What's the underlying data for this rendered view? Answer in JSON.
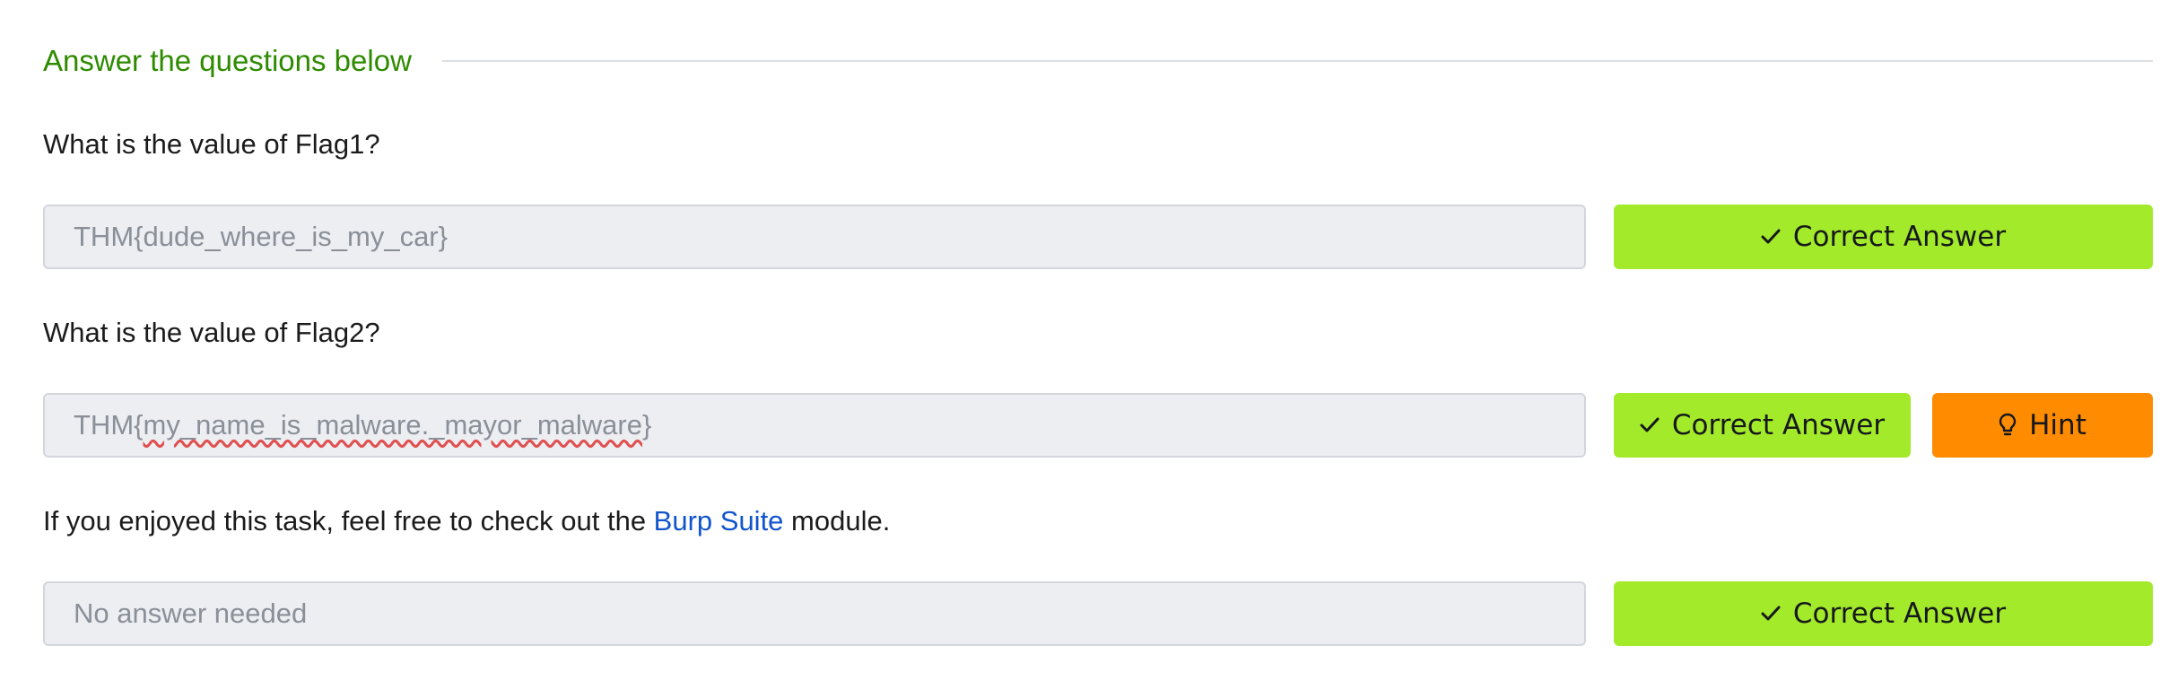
{
  "section": {
    "title": "Answer the questions below"
  },
  "questions": [
    {
      "prompt": "What is the value of Flag1?",
      "answer_value": "THM{dude_where_is_my_car}",
      "correct_label": "Correct Answer"
    },
    {
      "prompt": "What is the value of Flag2?",
      "answer_prefix": "THM{",
      "answer_spellflag": "my_name_is_malware._mayor_malware",
      "answer_suffix": "}",
      "correct_label": "Correct Answer",
      "hint_label": "Hint"
    },
    {
      "prompt_before": "If you enjoyed this task, feel free to check out the ",
      "prompt_link": "Burp Suite",
      "prompt_after": " module.",
      "answer_value": "No answer needed",
      "correct_label": "Correct Answer"
    }
  ],
  "colors": {
    "section_title": "#2e8b00",
    "correct_button": "#a3ea2a",
    "hint_button": "#ff8c00",
    "link": "#1155cc"
  },
  "icons": {
    "correct": "check-icon",
    "hint": "lightbulb-icon"
  }
}
